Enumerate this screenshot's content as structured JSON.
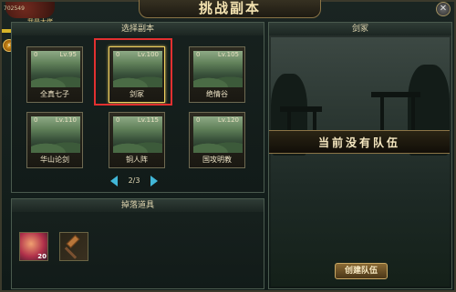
{
  "title": "挑战副本",
  "top_left": {
    "power_text": "702549",
    "vip_text": "我是大佬"
  },
  "panels": {
    "select_dungeon": "选择副本",
    "drops": "掉落道具",
    "detail_title": "剑冢"
  },
  "cards": [
    {
      "name": "全真七子",
      "count": "0",
      "level": "Lv.95"
    },
    {
      "name": "剑冢",
      "count": "0",
      "level": "Lv.100",
      "selected": true
    },
    {
      "name": "绝情谷",
      "count": "0",
      "level": "Lv.105"
    },
    {
      "name": "华山论剑",
      "count": "0",
      "level": "Lv.110"
    },
    {
      "name": "铜人阵",
      "count": "0",
      "level": "Lv.115"
    },
    {
      "name": "国攻明教",
      "count": "0",
      "level": "Lv.120"
    }
  ],
  "pager": {
    "text": "2/3"
  },
  "drops": [
    {
      "icon": "gift-pack-icon",
      "count": "20"
    },
    {
      "icon": "hammer-icon",
      "count": ""
    }
  ],
  "team_status": "当前没有队伍",
  "create_team": "创建队伍",
  "colors": {
    "accent_gold": "#c8a864",
    "selection_red": "#e23030",
    "arrow_blue": "#41b7d8"
  }
}
